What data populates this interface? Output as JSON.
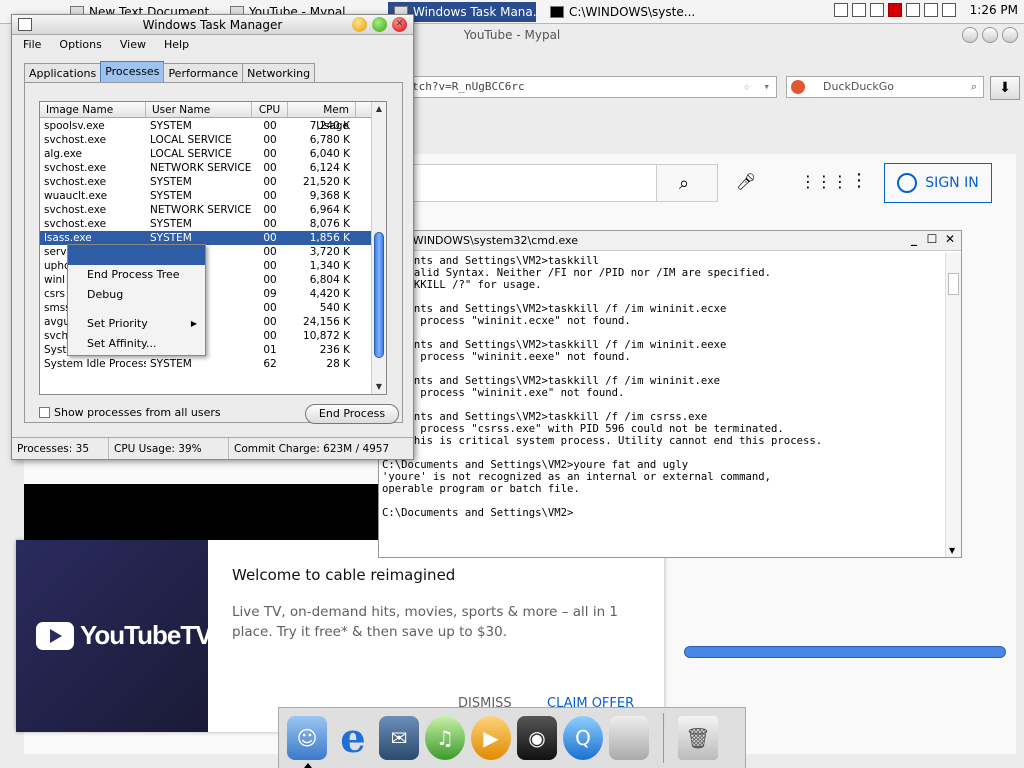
{
  "taskbar": {
    "buttons": [
      {
        "label": "New Text Document"
      },
      {
        "label": "YouTube - Mypal"
      },
      {
        "label": "Windows Task Mana..."
      },
      {
        "label": "C:\\WINDOWS\\syste..."
      }
    ],
    "clock": "1:26 PM"
  },
  "browser": {
    "window_title": "YouTube - Mypal",
    "url": "tch?v=R_nUgBCC6rc",
    "search_engine": "DuckDuckGo",
    "sign_in": "SIGN IN"
  },
  "promo": {
    "logo_text": "YouTubeTV",
    "title": "Welcome to cable reimagined",
    "body": "Live TV, on-demand hits, movies, sports & more – all in 1 place. Try it free* & then save up to $30.",
    "dismiss": "DISMISS",
    "claim": "CLAIM OFFER"
  },
  "cmd": {
    "title": "\\WINDOWS\\system32\\cmd.exe",
    "lines": [
      "ocuments and Settings\\VM2>taskkill",
      ": Invalid Syntax. Neither /FI nor /PID nor /IM are specified.",
      " \"TASKKILL /?\" for usage.",
      "",
      "ocuments and Settings\\VM2>taskkill /f /im wininit.ecxe",
      ": The process \"wininit.ecxe\" not found.",
      "",
      "ocuments and Settings\\VM2>taskkill /f /im wininit.eexe",
      ": The process \"wininit.eexe\" not found.",
      "",
      "ocuments and Settings\\VM2>taskkill /f /im wininit.exe",
      ": The process \"wininit.exe\" not found.",
      "",
      "ocuments and Settings\\VM2>taskkill /f /im csrss.exe",
      ": The process \"csrss.exe\" with PID 596 could not be terminated.",
      "on: This is critical system process. Utility cannot end this process.",
      "",
      "C:\\Documents and Settings\\VM2>youre fat and ugly",
      "'youre' is not recognized as an internal or external command,",
      "operable program or batch file.",
      "",
      "C:\\Documents and Settings\\VM2>"
    ]
  },
  "taskmgr": {
    "title": "Windows Task Manager",
    "menu": [
      "File",
      "Options",
      "View",
      "Help"
    ],
    "tabs": [
      "Applications",
      "Processes",
      "Performance",
      "Networking"
    ],
    "columns": [
      "Image Name",
      "User Name",
      "CPU",
      "Mem Usage"
    ],
    "rows": [
      [
        "spoolsv.exe",
        "SYSTEM",
        "00",
        "7,240 K"
      ],
      [
        "svchost.exe",
        "LOCAL SERVICE",
        "00",
        "6,780 K"
      ],
      [
        "alg.exe",
        "LOCAL SERVICE",
        "00",
        "6,040 K"
      ],
      [
        "svchost.exe",
        "NETWORK SERVICE",
        "00",
        "6,124 K"
      ],
      [
        "svchost.exe",
        "SYSTEM",
        "00",
        "21,520 K"
      ],
      [
        "wuauclt.exe",
        "SYSTEM",
        "00",
        "9,368 K"
      ],
      [
        "svchost.exe",
        "NETWORK SERVICE",
        "00",
        "6,964 K"
      ],
      [
        "svchost.exe",
        "SYSTEM",
        "00",
        "8,076 K"
      ],
      [
        "lsass.exe",
        "SYSTEM",
        "00",
        "1,856 K"
      ],
      [
        "serv",
        "",
        "00",
        "3,720 K"
      ],
      [
        "uphc",
        "",
        "00",
        "1,340 K"
      ],
      [
        "winl",
        "",
        "00",
        "6,804 K"
      ],
      [
        "csrs",
        "",
        "09",
        "4,420 K"
      ],
      [
        "smss",
        "",
        "00",
        "540 K"
      ],
      [
        "avgu",
        "",
        "00",
        "24,156 K"
      ],
      [
        "svch",
        "",
        "00",
        "10,872 K"
      ],
      [
        "Syst",
        "",
        "01",
        "236 K"
      ],
      [
        "System Idle Process",
        "SYSTEM",
        "62",
        "28 K"
      ]
    ],
    "show_all_label": "Show processes from all users",
    "end_process": "End Process",
    "status": {
      "processes": "Processes: 35",
      "cpu": "CPU Usage: 39%",
      "commit": "Commit Charge: 623M / 4957"
    }
  },
  "context_menu": {
    "items": [
      "",
      "End Process Tree",
      "Debug",
      "Set Priority",
      "Set Affinity..."
    ]
  }
}
